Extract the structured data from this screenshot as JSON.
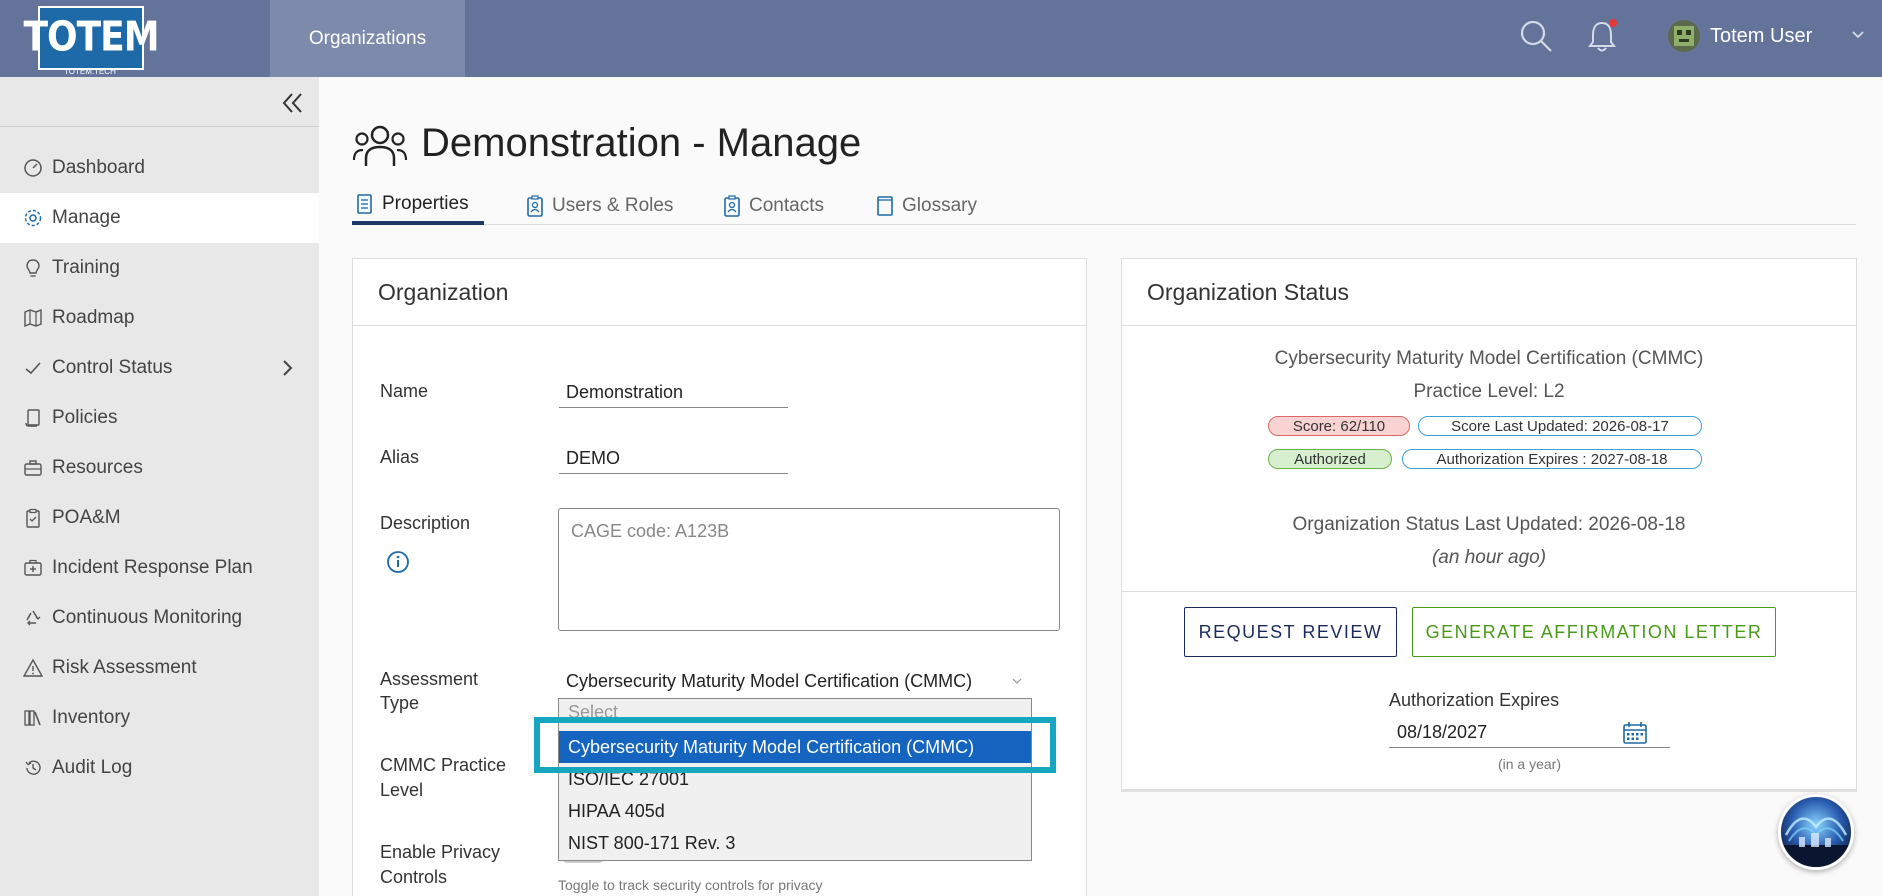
{
  "header": {
    "logo_text": "TOTEM",
    "logo_sub": "TOTEM.TECH",
    "nav_org": "Organizations",
    "user_name": "Totem User"
  },
  "sidebar": {
    "items": [
      {
        "label": "Dashboard",
        "icon": "dashboard-gauge-icon"
      },
      {
        "label": "Manage",
        "icon": "gear-icon"
      },
      {
        "label": "Training",
        "icon": "lightbulb-icon"
      },
      {
        "label": "Roadmap",
        "icon": "map-icon"
      },
      {
        "label": "Control Status",
        "icon": "checkmark-icon"
      },
      {
        "label": "Policies",
        "icon": "scroll-icon"
      },
      {
        "label": "Resources",
        "icon": "briefcase-icon"
      },
      {
        "label": "POA&M",
        "icon": "clipboard-icon"
      },
      {
        "label": "Incident Response Plan",
        "icon": "first-aid-icon"
      },
      {
        "label": "Continuous Monitoring",
        "icon": "recycle-icon"
      },
      {
        "label": "Risk Assessment",
        "icon": "warning-icon"
      },
      {
        "label": "Inventory",
        "icon": "inventory-icon"
      },
      {
        "label": "Audit Log",
        "icon": "history-icon"
      }
    ]
  },
  "page": {
    "title": "Demonstration - Manage",
    "tabs": [
      {
        "label": "Properties"
      },
      {
        "label": "Users & Roles"
      },
      {
        "label": "Contacts"
      },
      {
        "label": "Glossary"
      }
    ]
  },
  "org_card": {
    "title": "Organization",
    "name_label": "Name",
    "name_value": "Demonstration",
    "alias_label": "Alias",
    "alias_value": "DEMO",
    "description_label": "Description",
    "description_placeholder": "CAGE code: A123B",
    "assessment_label_1": "Assessment",
    "assessment_label_2": "Type",
    "assessment_value": "Cybersecurity Maturity Model Certification (CMMC)",
    "cmmc_label_1": "CMMC Practice",
    "cmmc_label_2": "Level",
    "privacy_label_1": "Enable Privacy",
    "privacy_label_2": "Controls",
    "privacy_hint": "Toggle to track security controls for privacy",
    "dropdown": {
      "search_placeholder": "Select",
      "options": [
        "Cybersecurity Maturity Model Certification (CMMC)",
        "ISO/IEC 27001",
        "HIPAA 405d",
        "NIST 800-171 Rev. 3"
      ],
      "selected_index": 0
    }
  },
  "status_card": {
    "title": "Organization Status",
    "framework": "Cybersecurity Maturity Model Certification (CMMC)",
    "practice_level": "Practice Level: L2",
    "score": "Score: 62/110",
    "score_updated": "Score Last Updated: 2026-08-17",
    "authorized": "Authorized",
    "auth_expires_pill": "Authorization Expires : 2027-08-18",
    "status_updated": "Organization Status Last Updated: 2026-08-18",
    "status_updated_rel": "(an hour ago)",
    "request_review": "REQUEST REVIEW",
    "generate_letter": "GENERATE AFFIRMATION LETTER",
    "auth_expires_label": "Authorization Expires",
    "auth_expires_date": "08/18/2027",
    "auth_expires_rel": "(in a year)"
  },
  "colors": {
    "header_bg": "#64739a",
    "nav_active_bg": "#7d8aab",
    "selected_option": "#1565c0",
    "highlight_border": "#16a6c0",
    "score_pill_bg": "#f9d2d2",
    "score_pill_border": "#d66",
    "authorized_pill_bg": "#d7efcf",
    "authorized_pill_border": "#6ab04c",
    "info_pill_border": "#3aa0d8",
    "request_btn": "#1a2a5e",
    "generate_btn": "#4a9a1a"
  }
}
